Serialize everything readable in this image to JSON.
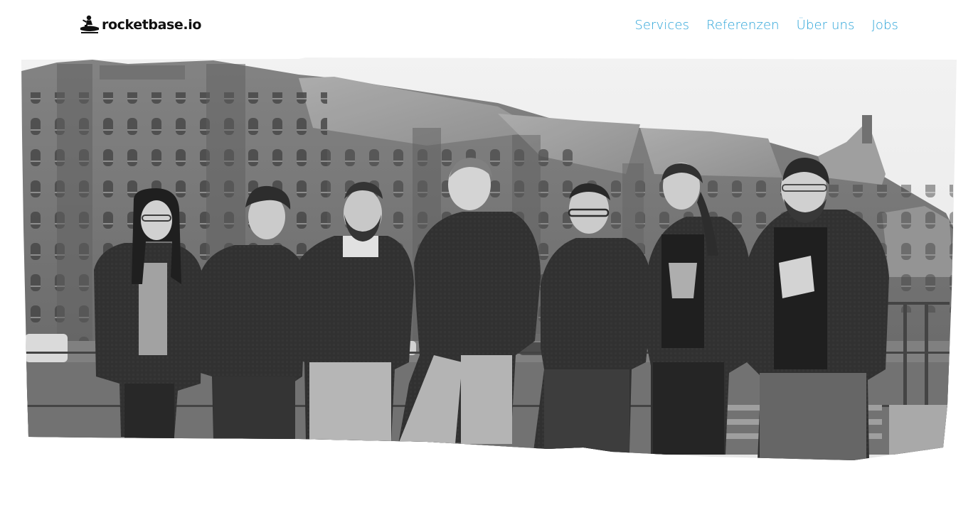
{
  "header": {
    "logo_text": "rocketbase.io",
    "logo_icon": "rocket-rider-icon",
    "nav": [
      {
        "label": "Services"
      },
      {
        "label": "Referenzen"
      },
      {
        "label": "Über uns"
      },
      {
        "label": "Jobs"
      }
    ]
  },
  "hero": {
    "image": "team-photo",
    "style": "black-and-white",
    "people_count": 7
  },
  "colors": {
    "nav_link": "#2aa3d8",
    "logo_text": "#111111",
    "background": "#ffffff"
  }
}
